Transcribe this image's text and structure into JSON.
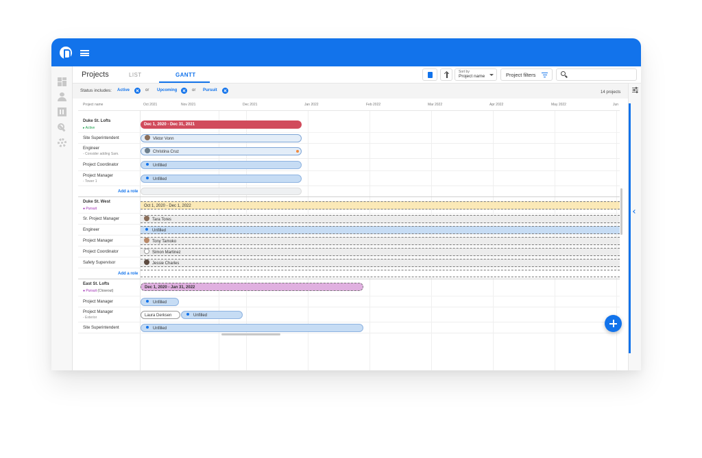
{
  "header": {
    "tabs": [
      {
        "label": "Projects"
      },
      {
        "label": "LIST"
      },
      {
        "label": "GANTT"
      }
    ]
  },
  "toolbar": {
    "sort_label": "Sort by",
    "sort_value": "Project name",
    "filters_label": "Project filters",
    "search_placeholder": ""
  },
  "status": {
    "label": "Status includes:",
    "chips": [
      "Active",
      "Upcoming",
      "Pursuit"
    ],
    "or": "or",
    "count": "14 projects"
  },
  "grid": {
    "name_header": "Project name",
    "months": [
      "Oct 2021",
      "Nov 2021",
      "Dec 2021",
      "Jan 2022",
      "Feb 2022",
      "Mar 2022",
      "Apr 2022",
      "May 2022",
      "Jun"
    ],
    "add_role": "Add a role"
  },
  "projects": [
    {
      "name": "Duke St. Lofts",
      "status": "Active",
      "range": "Dec 1, 2020 - Dec 31, 2021",
      "roles": [
        {
          "role": "Site Superintendent",
          "person": "Viktor Vonn"
        },
        {
          "role": "Engineer",
          "note": "- Consider adding Sam.",
          "person": "Christina Cruz"
        },
        {
          "role": "Project Coordinator",
          "person": "Unfilled"
        },
        {
          "role": "Project Manager",
          "note": "- Tower 1",
          "person": "Unfilled"
        }
      ]
    },
    {
      "name": "Duke St. West",
      "status": "Pursuit",
      "range": "Oct 1, 2020 - Dec 1, 2022",
      "roles": [
        {
          "role": "Sr. Project Manager",
          "person": "Tara Tores"
        },
        {
          "role": "Engineer",
          "person": "Unfilled"
        },
        {
          "role": "Project Manager",
          "person": "Tony Tamoko"
        },
        {
          "role": "Project Coordinator",
          "person": "Simon Martinez"
        },
        {
          "role": "Safety Supervisor",
          "person": "Jessie Charles"
        }
      ]
    },
    {
      "name": "East St. Lofts",
      "status": "Pursuit",
      "status_extra": "(Closeout)",
      "range": "Dec 1, 2020 - Jan 31, 2022",
      "roles": [
        {
          "role": "Project Manager",
          "person": "Unfilled"
        },
        {
          "role": "Project Manager",
          "note": "- Exterior",
          "person": "Laura Derksen",
          "person2": "Unfilled"
        },
        {
          "role": "Site Superintendent",
          "person": "Unfilled"
        }
      ]
    }
  ],
  "colors": {
    "brand": "#1273eb",
    "active": "#1a9e4a",
    "pursuit": "#9b27b0",
    "active_bar": "#d14b5c"
  }
}
